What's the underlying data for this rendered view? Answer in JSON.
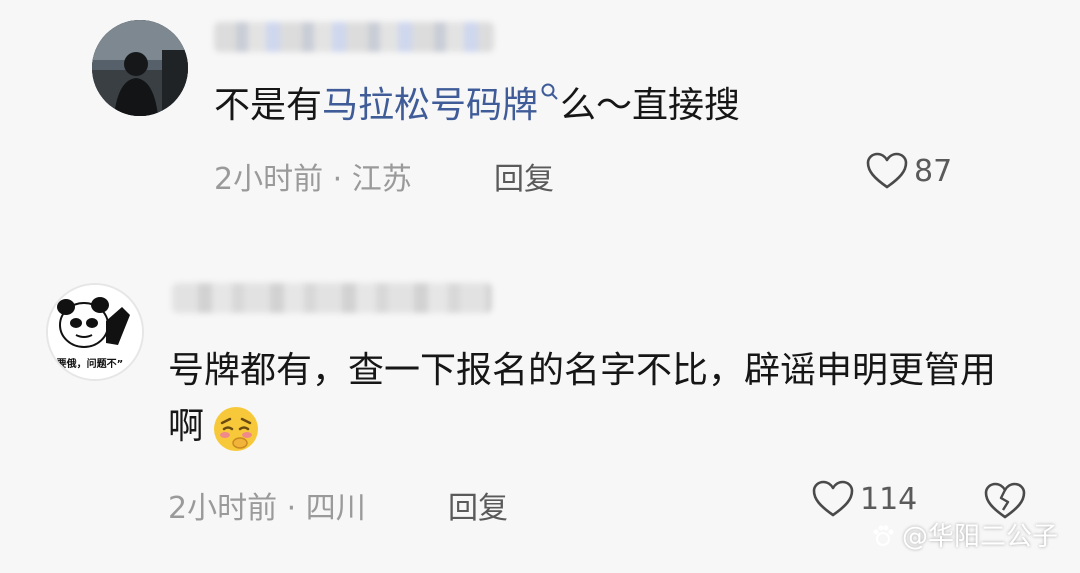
{
  "comments": [
    {
      "text_before": "不是有",
      "link_text": "马拉松号码牌",
      "text_after": "么～直接搜",
      "time_location": "2小时前 · 江苏",
      "reply_label": "回复",
      "like_count": "87"
    },
    {
      "text": "号牌都有，查一下报名的名字不比，辟谣申明更管用啊",
      "avatar_caption": "“要俄，问题不”",
      "time_location": "2小时前 · 四川",
      "reply_label": "回复",
      "like_count": "114"
    }
  ],
  "watermark": "@华阳二公子",
  "colors": {
    "link": "#3f5c98",
    "meta": "#9a9a9a",
    "background": "#f7f7f7"
  }
}
